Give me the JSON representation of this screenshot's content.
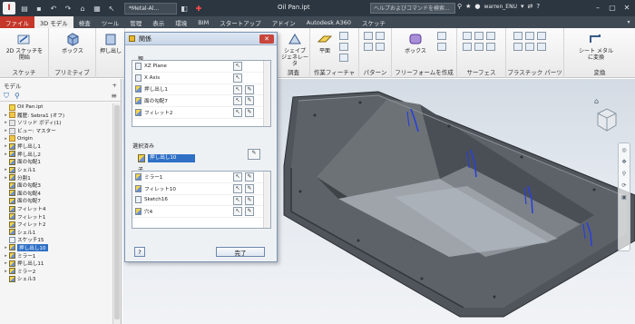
{
  "titlebar": {
    "app_icon": "I",
    "standard_dropdown": "*Metal-Al...",
    "document_title": "Oil Pan.ipt",
    "search_placeholder": "ヘルプおよびコマンドを検索...",
    "user_name": "warren_ENU",
    "quick_tools": [
      "folder-icon",
      "save-icon",
      "undo-icon",
      "redo-icon",
      "home-icon",
      "print-icon",
      "select-icon",
      "material-icon",
      "add-icon"
    ]
  },
  "tabs": [
    {
      "label": "ファイル",
      "kind": "file"
    },
    {
      "label": "3D モデル",
      "kind": "active"
    },
    {
      "label": "検査",
      "kind": ""
    },
    {
      "label": "ツール",
      "kind": ""
    },
    {
      "label": "管理",
      "kind": ""
    },
    {
      "label": "表示",
      "kind": ""
    },
    {
      "label": "環境",
      "kind": ""
    },
    {
      "label": "BIM",
      "kind": ""
    },
    {
      "label": "スタートアップ",
      "kind": ""
    },
    {
      "label": "アドイン",
      "kind": ""
    },
    {
      "label": "Autodesk A360",
      "kind": ""
    },
    {
      "label": "スケッチ",
      "kind": ""
    }
  ],
  "ribbon": {
    "sketch": {
      "button1": "2D スケッチを",
      "button1b": "開始",
      "label": "スケッチ"
    },
    "primitive": {
      "button": "ボックス",
      "label": "プリミティブ"
    },
    "create": {
      "button": "押し出し"
    },
    "modify_label": "調査",
    "shape": {
      "button1": "シェイプ",
      "button2": "ジェネレータ"
    },
    "plane": {
      "button": "平面",
      "label": "作業フィーチャ"
    },
    "pattern_label": "パターン",
    "freeform": {
      "button": "ボックス",
      "label": "フリーフォームを作成"
    },
    "surface_label": "サーフェス",
    "plastic_label": "プラスチック パーツ",
    "convert": {
      "button1": "シート メタル",
      "button2": "に変換",
      "label": "変換"
    }
  },
  "browser": {
    "title": "モデル",
    "items": [
      {
        "label": "Oil Pan.ipt",
        "icon": "doc",
        "indent": 1,
        "tw": ""
      },
      {
        "label": "履歴: Sebra1 (オフ)",
        "icon": "folder",
        "indent": 1,
        "tw": "▸"
      },
      {
        "label": "ソリッド ボディ(1)",
        "icon": "fold2",
        "indent": 1,
        "tw": "▸"
      },
      {
        "label": "ビュー: マスター",
        "icon": "fold2",
        "indent": 1,
        "tw": "▸"
      },
      {
        "label": "Origin",
        "icon": "folder",
        "indent": 1,
        "tw": "▸"
      },
      {
        "label": "押し出し1",
        "icon": "feat",
        "indent": 1,
        "tw": "▸"
      },
      {
        "label": "押し出し2",
        "icon": "feat",
        "indent": 1,
        "tw": "▸"
      },
      {
        "label": "面の勾配1",
        "icon": "feat",
        "indent": 1,
        "tw": ""
      },
      {
        "label": "シェル1",
        "icon": "feat",
        "indent": 1,
        "tw": "▸"
      },
      {
        "label": "分割1",
        "icon": "feat",
        "indent": 1,
        "tw": "▸"
      },
      {
        "label": "面の勾配3",
        "icon": "feat",
        "indent": 1,
        "tw": ""
      },
      {
        "label": "面の勾配4",
        "icon": "feat",
        "indent": 1,
        "tw": ""
      },
      {
        "label": "面の勾配7",
        "icon": "feat",
        "indent": 1,
        "tw": ""
      },
      {
        "label": "フィレット4",
        "icon": "feat",
        "indent": 1,
        "tw": ""
      },
      {
        "label": "フィレット1",
        "icon": "feat",
        "indent": 1,
        "tw": ""
      },
      {
        "label": "フィレット2",
        "icon": "feat",
        "indent": 1,
        "tw": ""
      },
      {
        "label": "シェル1",
        "icon": "feat",
        "indent": 1,
        "tw": ""
      },
      {
        "label": "スケッチ15",
        "icon": "sketch",
        "indent": 1,
        "tw": ""
      },
      {
        "label": "押し出し10",
        "icon": "feat",
        "indent": 1,
        "tw": "▸",
        "selected": true
      },
      {
        "label": "ミラー1",
        "icon": "feat",
        "indent": 1,
        "tw": "▸"
      },
      {
        "label": "押し出し11",
        "icon": "feat",
        "indent": 1,
        "tw": "▸"
      },
      {
        "label": "ミラー2",
        "icon": "feat",
        "indent": 1,
        "tw": "▸"
      },
      {
        "label": "シェル3",
        "icon": "feat",
        "indent": 1,
        "tw": ""
      }
    ]
  },
  "dialog": {
    "title": "関係",
    "parents_label": "親",
    "parents": [
      {
        "label": "XZ Plane",
        "icon": "plane"
      },
      {
        "label": "X Axis",
        "icon": "plane"
      },
      {
        "label": "押し出し1",
        "icon": "feat"
      },
      {
        "label": "面の勾配7",
        "icon": "feat"
      },
      {
        "label": "フィレット2",
        "icon": "feat"
      }
    ],
    "selected_label": "選択済み",
    "selected_value": "押し出し10",
    "children_label": "子",
    "children": [
      {
        "label": "ミラー1",
        "icon": "feat"
      },
      {
        "label": "フィレット10",
        "icon": "feat"
      },
      {
        "label": "Sketch16",
        "icon": "sketch"
      },
      {
        "label": "穴4",
        "icon": "feat"
      }
    ],
    "help_label": "?",
    "done_label": "完了"
  },
  "colors": {
    "titlebar": "#2c3640",
    "file_tab": "#c4372a",
    "selection": "#2f70c6",
    "highlight_edges": "#2a40d8",
    "part_body": "#3e4247"
  }
}
